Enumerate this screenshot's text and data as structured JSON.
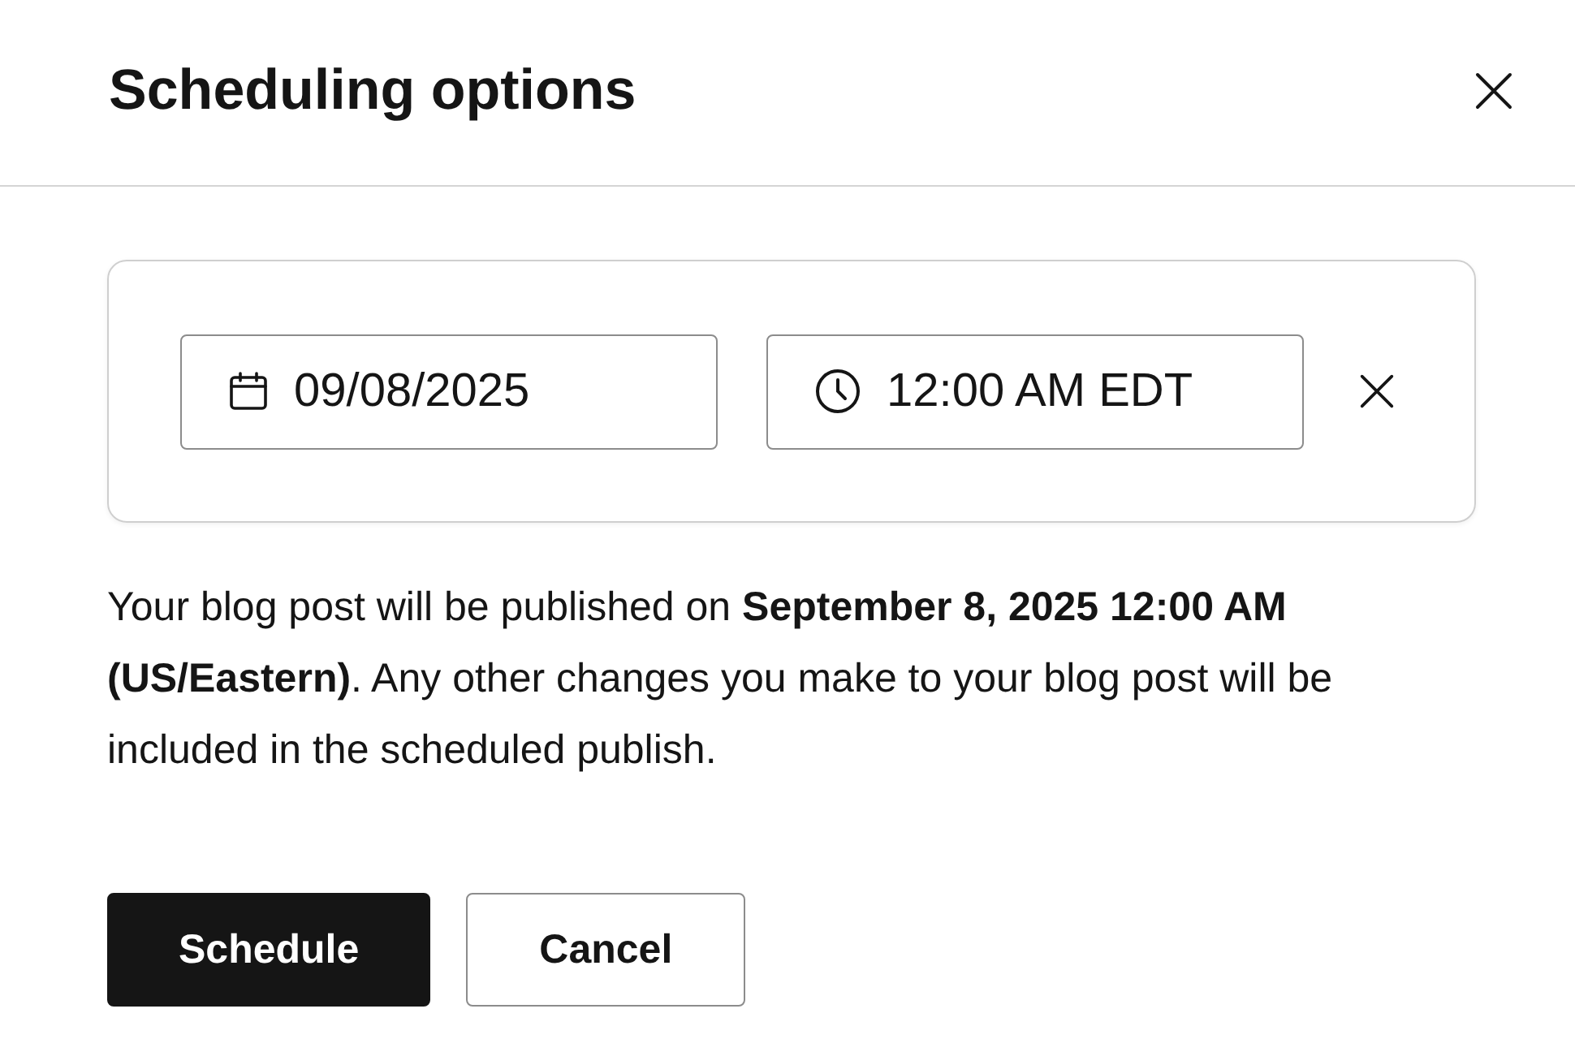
{
  "dialog": {
    "title": "Scheduling options"
  },
  "schedule": {
    "fields": [
      {
        "kind": "date",
        "value": "09/08/2025"
      },
      {
        "kind": "time",
        "value": "12:00 AM EDT"
      }
    ]
  },
  "message": "Your blog post will be published on **September 8, 2025 12:00 AM (US/Eastern)**. Any other changes you make to your blog post will be included in the scheduled publish.",
  "buttons": [
    {
      "label": "Schedule",
      "kind": "primary"
    },
    {
      "label": "Cancel",
      "kind": "secondary"
    }
  ]
}
